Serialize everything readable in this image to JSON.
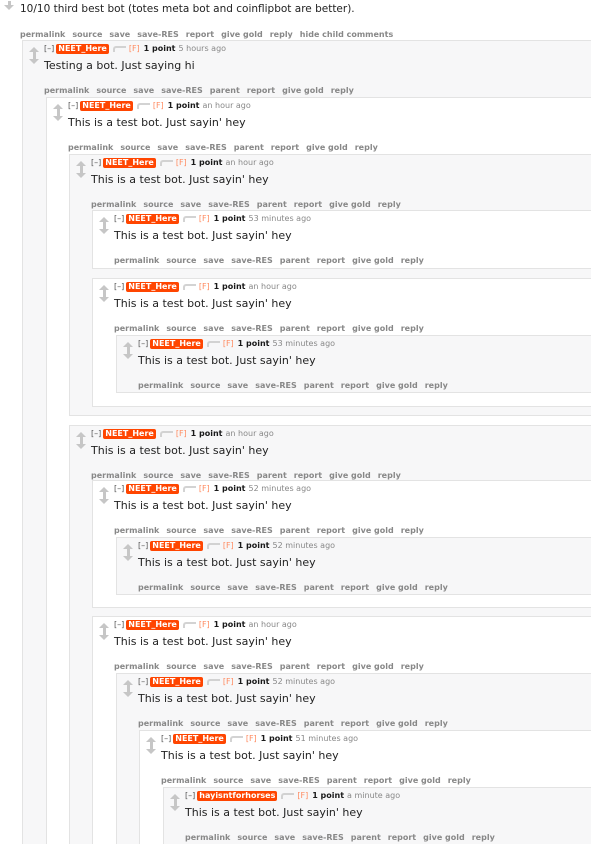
{
  "parent_comment": {
    "body": "10/10 third best bot (totes meta bot and coinflipbot are better).",
    "buttons": [
      "permalink",
      "source",
      "save",
      "save-RES",
      "report",
      "give gold",
      "reply",
      "hide child comments"
    ]
  },
  "comments": [
    {
      "id": "c0",
      "depth": 0,
      "expand": "[–]",
      "author": "NEET_Here",
      "flag": "[F]",
      "score": "1 point",
      "time": "5 hours ago",
      "body": "Testing a bot. Just saying hi",
      "buttons": [
        "permalink",
        "source",
        "save",
        "save-RES",
        "parent",
        "report",
        "give gold",
        "reply"
      ]
    },
    {
      "id": "c1",
      "depth": 1,
      "expand": "[–]",
      "author": "NEET_Here",
      "flag": "[F]",
      "score": "1 point",
      "time": "an hour ago",
      "body": "This is a test bot. Just sayin' hey",
      "buttons": [
        "permalink",
        "source",
        "save",
        "save-RES",
        "parent",
        "report",
        "give gold",
        "reply"
      ]
    },
    {
      "id": "c2",
      "depth": 2,
      "expand": "[–]",
      "author": "NEET_Here",
      "flag": "[F]",
      "score": "1 point",
      "time": "an hour ago",
      "body": "This is a test bot. Just sayin' hey",
      "buttons": [
        "permalink",
        "source",
        "save",
        "save-RES",
        "parent",
        "report",
        "give gold",
        "reply"
      ]
    },
    {
      "id": "c3",
      "depth": 3,
      "expand": "[–]",
      "author": "NEET_Here",
      "flag": "[F]",
      "score": "1 point",
      "time": "53 minutes ago",
      "body": "This is a test bot. Just sayin' hey",
      "buttons": [
        "permalink",
        "source",
        "save",
        "save-RES",
        "parent",
        "report",
        "give gold",
        "reply"
      ]
    },
    {
      "id": "c4",
      "depth": 3,
      "expand": "[–]",
      "author": "NEET_Here",
      "flag": "[F]",
      "score": "1 point",
      "time": "an hour ago",
      "body": "This is a test bot. Just sayin' hey",
      "buttons": [
        "permalink",
        "source",
        "save",
        "save-RES",
        "parent",
        "report",
        "give gold",
        "reply"
      ]
    },
    {
      "id": "c5",
      "depth": 4,
      "expand": "[–]",
      "author": "NEET_Here",
      "flag": "[F]",
      "score": "1 point",
      "time": "53 minutes ago",
      "body": "This is a test bot. Just sayin' hey",
      "buttons": [
        "permalink",
        "source",
        "save",
        "save-RES",
        "parent",
        "report",
        "give gold",
        "reply"
      ]
    },
    {
      "id": "c6",
      "depth": 2,
      "expand": "[–]",
      "author": "NEET_Here",
      "flag": "[F]",
      "score": "1 point",
      "time": "an hour ago",
      "body": "This is a test bot. Just sayin' hey",
      "buttons": [
        "permalink",
        "source",
        "save",
        "save-RES",
        "parent",
        "report",
        "give gold",
        "reply"
      ]
    },
    {
      "id": "c7",
      "depth": 3,
      "expand": "[–]",
      "author": "NEET_Here",
      "flag": "[F]",
      "score": "1 point",
      "time": "52 minutes ago",
      "body": "This is a test bot. Just sayin' hey",
      "buttons": [
        "permalink",
        "source",
        "save",
        "save-RES",
        "parent",
        "report",
        "give gold",
        "reply"
      ]
    },
    {
      "id": "c8",
      "depth": 4,
      "expand": "[–]",
      "author": "NEET_Here",
      "flag": "[F]",
      "score": "1 point",
      "time": "52 minutes ago",
      "body": "This is a test bot. Just sayin' hey",
      "buttons": [
        "permalink",
        "source",
        "save",
        "save-RES",
        "parent",
        "report",
        "give gold",
        "reply"
      ]
    },
    {
      "id": "c9",
      "depth": 3,
      "expand": "[–]",
      "author": "NEET_Here",
      "flag": "[F]",
      "score": "1 point",
      "time": "an hour ago",
      "body": "This is a test bot. Just sayin' hey",
      "buttons": [
        "permalink",
        "source",
        "save",
        "save-RES",
        "parent",
        "report",
        "give gold",
        "reply"
      ]
    },
    {
      "id": "c10",
      "depth": 4,
      "expand": "[–]",
      "author": "NEET_Here",
      "flag": "[F]",
      "score": "1 point",
      "time": "52 minutes ago",
      "body": "This is a test bot. Just sayin' hey",
      "buttons": [
        "permalink",
        "source",
        "save",
        "save-RES",
        "parent",
        "report",
        "give gold",
        "reply"
      ]
    },
    {
      "id": "c11",
      "depth": 5,
      "expand": "[–]",
      "author": "NEET_Here",
      "flag": "[F]",
      "score": "1 point",
      "time": "51 minutes ago",
      "body": "This is a test bot. Just sayin' hey",
      "buttons": [
        "permalink",
        "source",
        "save",
        "save-RES",
        "parent",
        "report",
        "give gold",
        "reply"
      ]
    },
    {
      "id": "c12",
      "depth": 6,
      "expand": "[–]",
      "author": "hayisntforhorses",
      "flag": "[F]",
      "score": "1 point",
      "time": "a minute ago",
      "body": "This is a test bot. Just sayin' hey",
      "buttons": [
        "permalink",
        "source",
        "save",
        "save-RES",
        "parent",
        "report",
        "give gold",
        "reply"
      ]
    }
  ],
  "colors": {
    "author_badge": "#ff4500",
    "flag": "#ff8b60",
    "muted_text": "#888888",
    "box_border": "#e3e3e3",
    "odd_background": "#f7f7f8"
  }
}
